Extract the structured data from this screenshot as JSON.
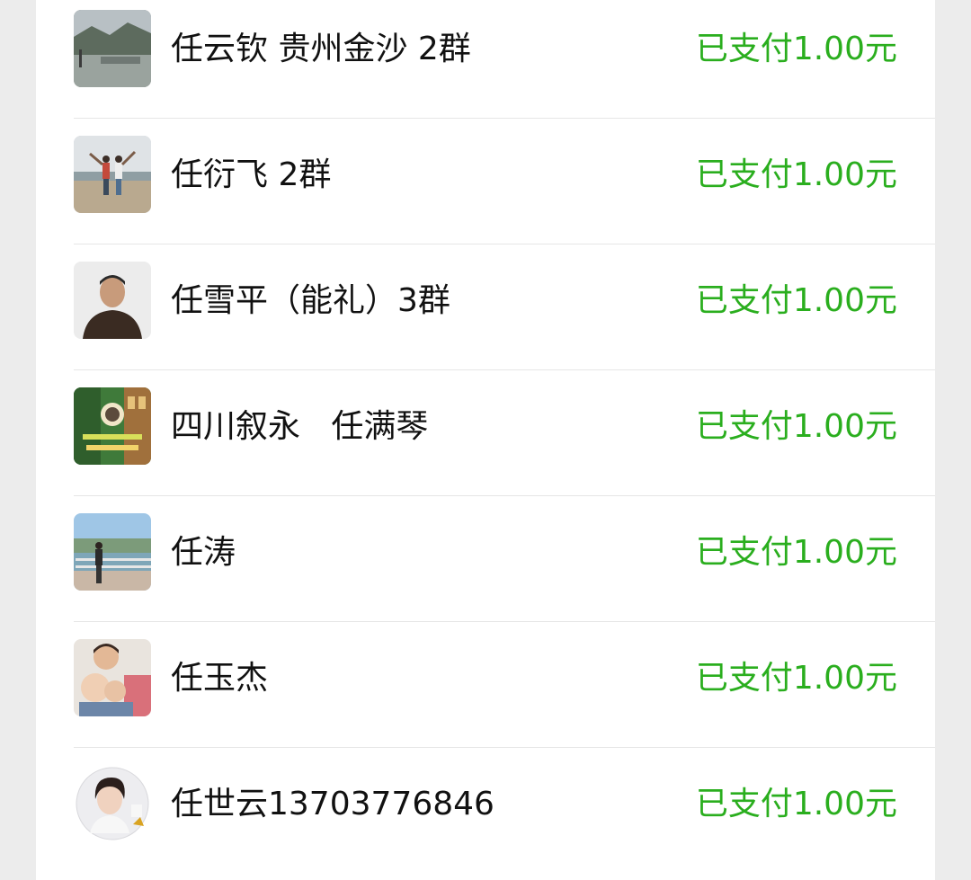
{
  "colors": {
    "status_green": "#2aae1e",
    "name_text": "#111111",
    "divider": "#e6e6e6",
    "background": "#ececec"
  },
  "payments": [
    {
      "name": "任云钦 贵州金沙 2群",
      "status": "已支付1.00元",
      "avatar_icon": "landscape-photo-avatar"
    },
    {
      "name": "任衍飞 2群",
      "status": "已支付1.00元",
      "avatar_icon": "beach-couple-photo-avatar"
    },
    {
      "name": "任雪平（能礼）3群",
      "status": "已支付1.00元",
      "avatar_icon": "portrait-photo-avatar"
    },
    {
      "name": "四川叙永   任满琴",
      "status": "已支付1.00元",
      "avatar_icon": "garden-collage-avatar"
    },
    {
      "name": "任涛",
      "status": "已支付1.00元",
      "avatar_icon": "riverside-photo-avatar"
    },
    {
      "name": "任玉杰",
      "status": "已支付1.00元",
      "avatar_icon": "family-photo-avatar"
    },
    {
      "name": "任世云13703776846",
      "status": "已支付1.00元",
      "avatar_icon": "round-portrait-avatar"
    }
  ]
}
